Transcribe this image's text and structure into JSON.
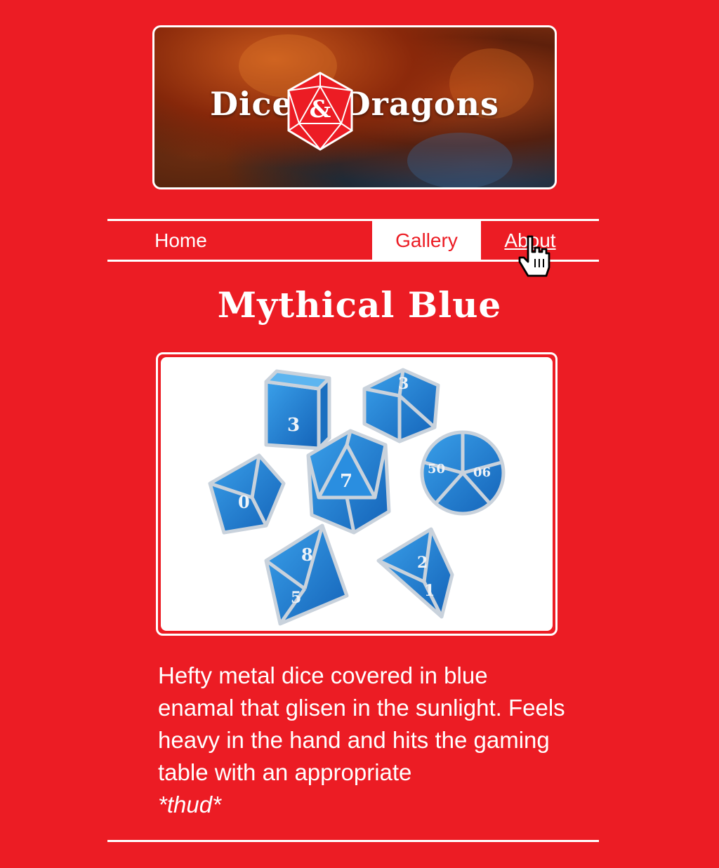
{
  "banner": {
    "title_left": "Dice",
    "title_right": "Dragons",
    "logo_symbol": "&",
    "logo_icon": "d20-ampersand-icon"
  },
  "nav": {
    "items": [
      {
        "label": "Home",
        "active": false
      },
      {
        "label": "Gallery",
        "active": true
      },
      {
        "label": "About",
        "active": false,
        "hovered": true
      }
    ],
    "cursor_icon": "hand-pointer-icon"
  },
  "product": {
    "title": "Mythical Blue",
    "image_icon": "blue-metal-dice-set-image",
    "description": "Hefty metal dice covered in blue enamal that glisen in the sunlight. Feels heavy in the hand and hits the gaming table with an appropriate",
    "description_emphasis": "*thud*"
  },
  "colors": {
    "background": "#ec1c24",
    "text": "#ffffff",
    "dice_blue": "#1f86d6"
  }
}
